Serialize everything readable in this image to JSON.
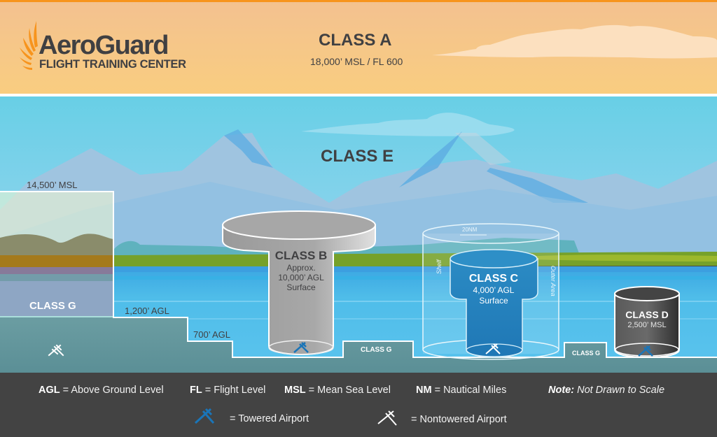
{
  "brand": {
    "name": "AeroGuard",
    "subtitle": "FLIGHT TRAINING CENTER",
    "accent_color": "#f7941d",
    "text_color": "#404042"
  },
  "classes": {
    "a": {
      "title": "CLASS A",
      "detail": "18,000’ MSL / FL 600"
    },
    "e": {
      "title": "CLASS E"
    },
    "b": {
      "title": "CLASS B",
      "lines": [
        "Approx.",
        "10,000’ AGL",
        "Surface"
      ]
    },
    "c": {
      "title": "CLASS C",
      "lines": [
        "4,000’ AGL",
        "Surface"
      ],
      "radius_label": "20NM",
      "shelf_label": "Shelf",
      "outer_label": "Outer Area"
    },
    "d": {
      "title": "CLASS D",
      "detail": "2,500’ MSL"
    },
    "g_left": {
      "title": "CLASS G"
    },
    "g_mid": {
      "title": "CLASS G"
    },
    "g_right": {
      "title": "CLASS G"
    }
  },
  "altitudes": {
    "msl_14500": "14,500’ MSL",
    "agl_1200": "1,200’ AGL",
    "agl_700": "700’ AGL"
  },
  "legend": {
    "abbreviations": [
      {
        "abbr": "AGL",
        "meaning": "= Above Ground Level"
      },
      {
        "abbr": "FL",
        "meaning": "= Flight Level"
      },
      {
        "abbr": "MSL",
        "meaning": "= Mean Sea Level"
      },
      {
        "abbr": "NM",
        "meaning": "= Nautical Miles"
      }
    ],
    "note_label": "Note:",
    "note_text": "Not Drawn to Scale",
    "towered": {
      "icon": "towered-airport-icon",
      "label": "= Towered Airport",
      "color": "#1a75b8"
    },
    "nontowered": {
      "icon": "nontowered-airport-icon",
      "label": "= Nontowered Airport",
      "color": "#ffffff"
    }
  }
}
